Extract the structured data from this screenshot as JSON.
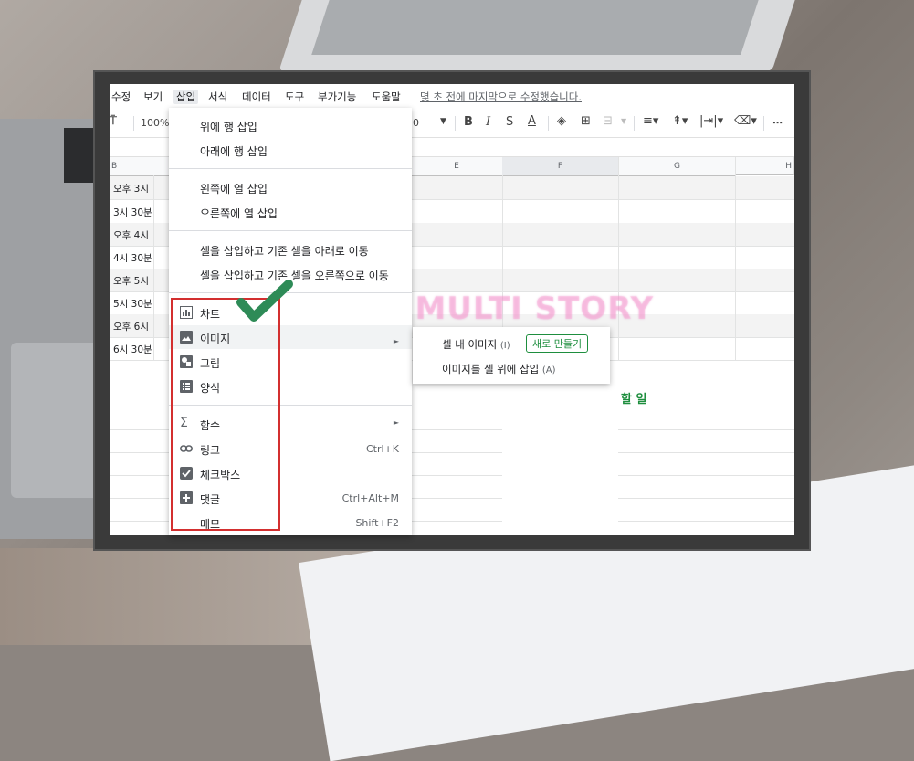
{
  "menubar": {
    "items": [
      "수정",
      "보기",
      "삽입",
      "서식",
      "데이터",
      "도구",
      "부가기능",
      "도움말"
    ],
    "last_edit": "몇 초 전에 마지막으로 수정했습니다."
  },
  "toolbar": {
    "zoom": "100%",
    "font_size": "0",
    "bold": "B",
    "italic": "I",
    "strike": "S",
    "text_color": "A",
    "more": "⋯"
  },
  "grid": {
    "columns": [
      "B",
      "E",
      "F",
      "G",
      "H"
    ],
    "row_labels": [
      "오후 3시",
      "3시 30분",
      "오후 4시",
      "4시 30분",
      "오후 5시",
      "5시 30분",
      "오후 6시",
      "6시 30분"
    ],
    "todo_label": "할 일"
  },
  "insert_menu": {
    "items": [
      {
        "label": "위에 행 삽입"
      },
      {
        "label": "아래에 행 삽입"
      },
      {
        "label": "왼쪽에 열 삽입"
      },
      {
        "label": "오른쪽에 열 삽입"
      },
      {
        "label": "셀을 삽입하고 기존 셀을 아래로 이동"
      },
      {
        "label": "셀을 삽입하고 기존 셀을 오른쪽으로 이동"
      },
      {
        "label": "차트",
        "icon": "chart-icon"
      },
      {
        "label": "이미지",
        "icon": "image-icon"
      },
      {
        "label": "그림",
        "icon": "drawing-icon"
      },
      {
        "label": "양식",
        "icon": "form-icon"
      },
      {
        "label": "함수",
        "icon": "sigma-icon"
      },
      {
        "label": "링크",
        "icon": "link-icon",
        "shortcut": "Ctrl+K"
      },
      {
        "label": "체크박스",
        "icon": "checkbox-icon"
      },
      {
        "label": "댓글",
        "icon": "comment-icon",
        "shortcut": "Ctrl+Alt+M"
      },
      {
        "label": "메모",
        "shortcut": "Shift+F2"
      }
    ]
  },
  "image_submenu": {
    "in_cell": "셀 내 이미지",
    "in_cell_key": "(I)",
    "new_badge": "새로 만들기",
    "over_cells": "이미지를 셀 위에 삽입",
    "over_cells_key": "(A)"
  },
  "watermark": "SWEET MULTI STORY",
  "colors": {
    "accent_green": "#1e8e3e",
    "highlight_red": "#d32f2f",
    "check_green": "#2e8b57"
  }
}
